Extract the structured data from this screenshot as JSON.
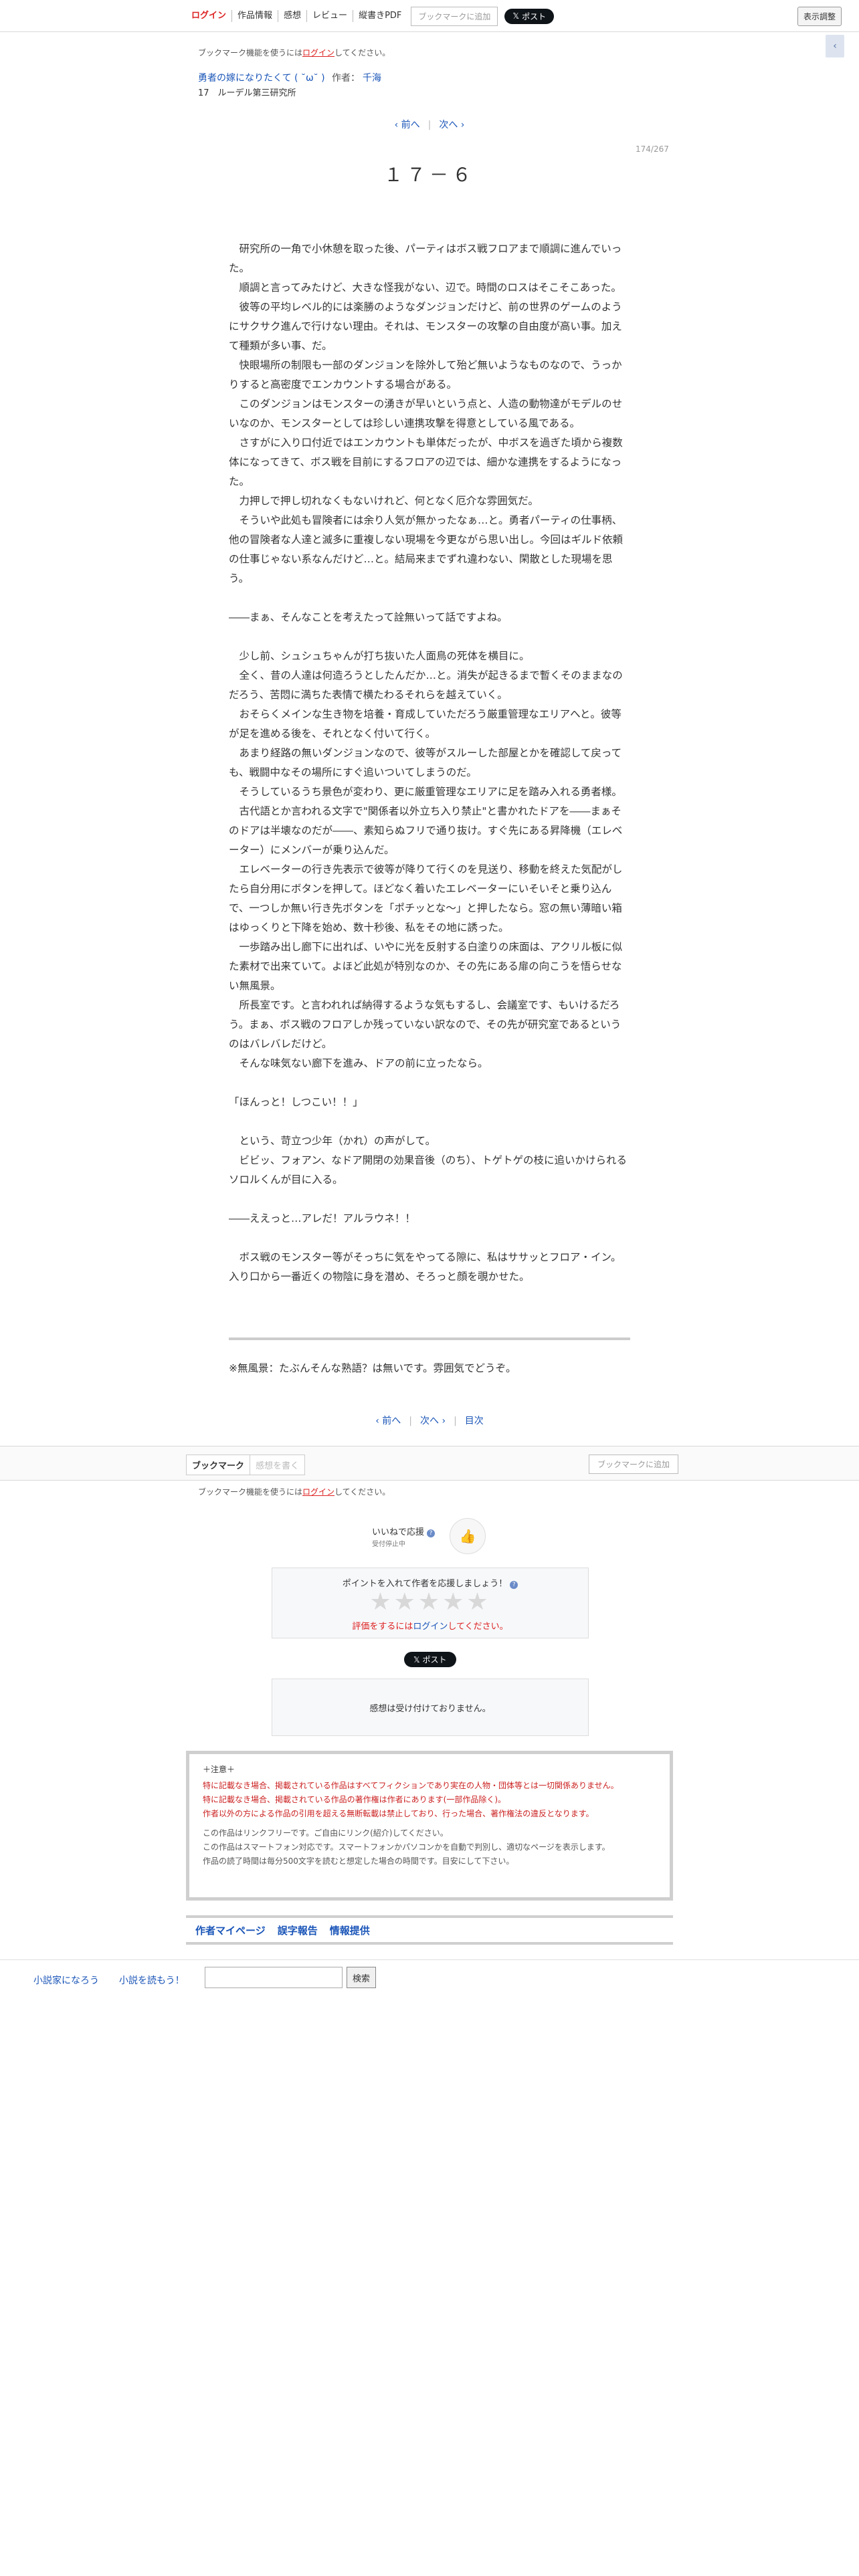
{
  "topbar": {
    "menu": [
      "ログイン",
      "作品情報",
      "感想",
      "レビュー",
      "縦書きPDF"
    ],
    "bookmark_add": "ブックマークに追加",
    "post": "ポスト",
    "display_settings": "表示調整",
    "side_tab": "‹"
  },
  "header": {
    "bookmark_note_pre": "ブックマーク機能を使うには",
    "bookmark_note_link": "ログイン",
    "bookmark_note_post": "してください。",
    "series_title": "勇者の嫁になりたくて ( ˘ω˘ ) ",
    "author_label": "作者：",
    "author": "千海",
    "chapter_sub": "17　ルーデル第三研究所"
  },
  "pager": {
    "prev": "‹ 前へ",
    "next": "次へ ›",
    "toc": "目次",
    "page_count": "174/267"
  },
  "chapter_title": "１７－６",
  "body": [
    "　研究所の一角で小休憩を取った後、パーティはボス戦フロアまで順調に進んでいった。",
    "　順調と言ってみたけど、大きな怪我がない、辺で。時間のロスはそこそこあった。",
    "　彼等の平均レベル的には楽勝のようなダンジョンだけど、前の世界のゲームのようにサクサク進んで行けない理由。それは、モンスターの攻撃の自由度が高い事。加えて種類が多い事、だ。",
    "　快眼場所の制限も一部のダンジョンを除外して殆ど無いようなものなので、うっかりすると高密度でエンカウントする場合がある。",
    "　このダンジョンはモンスターの湧きが早いという点と、人造の動物達がモデルのせいなのか、モンスターとしては珍しい連携攻撃を得意としている風である。",
    "　さすがに入り口付近ではエンカウントも単体だったが、中ボスを過ぎた頃から複数体になってきて、ボス戦を目前にするフロアの辺では、細かな連携をするようになった。",
    "　力押しで押し切れなくもないけれど、何となく厄介な雰囲気だ。",
    "　そういや此処も冒険者には余り人気が無かったなぁ…と。勇者パーティの仕事柄、他の冒険者な人達と滅多に重複しない現場を今更ながら思い出し。今回はギルド依頼の仕事じゃない系なんだけど…と。結局来までずれ違わない、閑散とした現場を思う。",
    "",
    "――まぁ、そんなことを考えたって詮無いって話ですよね。",
    "",
    "　少し前、シュシュちゃんが打ち抜いた人面鳥の死体を横目に。",
    "　全く、昔の人達は何造ろうとしたんだか…と。消失が起きるまで暫くそのままなのだろう、苦悶に満ちた表情で横たわるそれらを越えていく。",
    "　おそらくメインな生き物を培養・育成していただろう厳重管理なエリアへと。彼等が足を進める後を、それとなく付いて行く。",
    "　あまり経路の無いダンジョンなので、彼等がスルーした部屋とかを確認して戻っても、戦闘中なその場所にすぐ追いついてしまうのだ。",
    "　そうしているうち景色が変わり、更に厳重管理なエリアに足を踏み入れる勇者様。",
    "　古代語とか言われる文字で\"関係者以外立ち入り禁止\"と書かれたドアを――まぁそのドアは半壊なのだが――、素知らぬフリで通り抜け。すぐ先にある昇降機（エレベーター）にメンバーが乗り込んだ。",
    "　エレベーターの行き先表示で彼等が降りて行くのを見送り、移動を終えた気配がしたら自分用にボタンを押して。ほどなく着いたエレベーターにいそいそと乗り込んで、一つしか無い行き先ボタンを「ポチッとな～」と押したなら。窓の無い薄暗い箱はゆっくりと下降を始め、数十秒後、私をその地に誘った。",
    "　一歩踏み出し廊下に出れば、いやに光を反射する白塗りの床面は、アクリル板に似た素材で出来ていて。よほど此処が特別なのか、その先にある扉の向こうを悟らせない無風景。",
    "　所長室です。と言われれば納得するような気もするし、会議室です、もいけるだろう。まぁ、ボス戦のフロアしか残っていない訳なので、その先が研究室であるというのはバレバレだけど。",
    "　そんな味気ない廊下を進み、ドアの前に立ったなら。",
    "",
    "「ほんっと！しつこい！！」",
    "",
    "　という、苛立つ少年（かれ）の声がして。",
    "　ビビッ、フォアン、なドア開閉の効果音後（のち）、トゲトゲの枝に追いかけられるソロルくんが目に入る。",
    "",
    "――ええっと…アレだ！アルラウネ！！",
    "",
    "　ボス戦のモンスター等がそっちに気をやってる隙に、私はササッとフロア・イン。入り口から一番近くの物陰に身を潜め、そろっと顔を覗かせた。"
  ],
  "afterword": "※無風景：たぶんそんな熟語？は無いです。雰囲気でどうぞ。",
  "bookmark_strip": {
    "tab_bookmark": "ブックマーク",
    "tab_review": "感想を書く",
    "add": "ブックマークに追加"
  },
  "like": {
    "label": "いいねで応援",
    "sub": "受付停止中"
  },
  "rating": {
    "title": "ポイントを入れて作者を応援しましょう！",
    "stars": "★★★★★",
    "note_pre": "評価をするには",
    "note_login": "ログイン",
    "note_post": "してください。"
  },
  "review_box": "感想は受け付けておりません。",
  "notice": {
    "head": "＋注意＋",
    "red": [
      "特に記載なき場合、掲載されている作品はすべてフィクションであり実在の人物・団体等とは一切関係ありません。",
      "特に記載なき場合、掲載されている作品の著作権は作者にあります(一部作品除く)。",
      "作者以外の方による作品の引用を超える無断転載は禁止しており、行った場合、著作権法の違反となります。"
    ],
    "gray": [
      "この作品はリンクフリーです。ご自由にリンク(紹介)してください。",
      "この作品はスマートフォン対応です。スマートフォンかパソコンかを自動で判別し、適切なページを表示します。",
      "作品の読了時間は毎分500文字を読むと想定した場合の時間です。目安にして下さい。"
    ]
  },
  "author_links": [
    "作者マイページ",
    "誤字報告",
    "情報提供"
  ],
  "site_footer": {
    "write": "小説家になろう",
    "read": "小説を読もう！",
    "search_button": "検索"
  }
}
